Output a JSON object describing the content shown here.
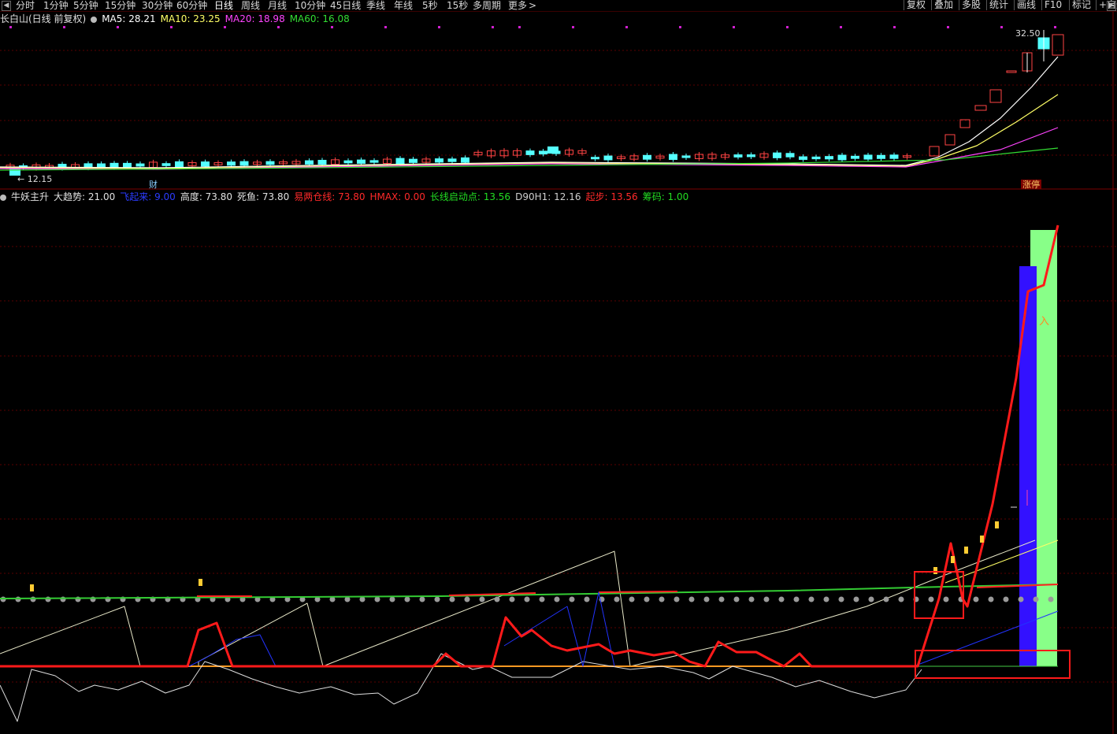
{
  "toolbar": {
    "left_arrow": "◀",
    "right_arrow": "▶",
    "periods": [
      {
        "label": "分时"
      },
      {
        "label": "1分钟"
      },
      {
        "label": "5分钟"
      },
      {
        "label": "15分钟"
      },
      {
        "label": "30分钟"
      },
      {
        "label": "60分钟"
      },
      {
        "label": "日线",
        "active": true
      },
      {
        "label": "周线"
      },
      {
        "label": "月线"
      },
      {
        "label": "10分钟"
      },
      {
        "label": "45日线"
      },
      {
        "label": "季线"
      },
      {
        "label": "年线"
      },
      {
        "label": "5秒"
      },
      {
        "label": "15秒"
      },
      {
        "label": "多周期"
      },
      {
        "label": "更多"
      }
    ],
    "more_arrow": ">",
    "tools": [
      "复权",
      "叠加",
      "多股",
      "统计",
      "画线",
      "F10",
      "标记",
      "+自选"
    ]
  },
  "price_panel": {
    "stock_title": "长白山(日线 前复权)",
    "indicators": [
      {
        "label": "MA5: 28.21",
        "color": "#ffffff"
      },
      {
        "label": "MA10: 23.25",
        "color": "#ffff66"
      },
      {
        "label": "MA20: 18.98",
        "color": "#ff44ff"
      },
      {
        "label": "MA60: 16.08",
        "color": "#33dd33"
      }
    ],
    "high_label": "32.50",
    "low_label": "12.15",
    "event_marker": "财",
    "limit_up_badge": "涨停"
  },
  "indicator_panel": {
    "name": "牛妖主升",
    "items": [
      {
        "label": "大趋势: 21.00",
        "color": "#e0e0e0"
      },
      {
        "label": "飞起来: 9.00",
        "color": "#2b3cff"
      },
      {
        "label": "高度: 73.80",
        "color": "#e0e0e0"
      },
      {
        "label": "死鱼: 73.80",
        "color": "#e0e0e0"
      },
      {
        "label": "易两仓线: 73.80",
        "color": "#ff2a2a"
      },
      {
        "label": "HMAX: 0.00",
        "color": "#ff2a2a"
      },
      {
        "label": "长线启动点: 13.56",
        "color": "#22dd22"
      },
      {
        "label": "D90H1: 12.16",
        "color": "#cfcfcf"
      },
      {
        "label": "起步: 13.56",
        "color": "#ff2a2a"
      },
      {
        "label": "筹码: 1.00",
        "color": "#22dd22"
      }
    ],
    "signal_marker": "入"
  },
  "colors": {
    "background": "#000000",
    "grid": "#5a0000",
    "rise": "#ff4444",
    "fall": "#55ffff",
    "ma5": "#ffffff",
    "ma10": "#ffff66",
    "ma20": "#ff44ff",
    "ma60": "#33dd33",
    "main_red": "#ff1a1a",
    "blue_bar": "#3311ff",
    "green_bar": "#88ff88"
  }
}
